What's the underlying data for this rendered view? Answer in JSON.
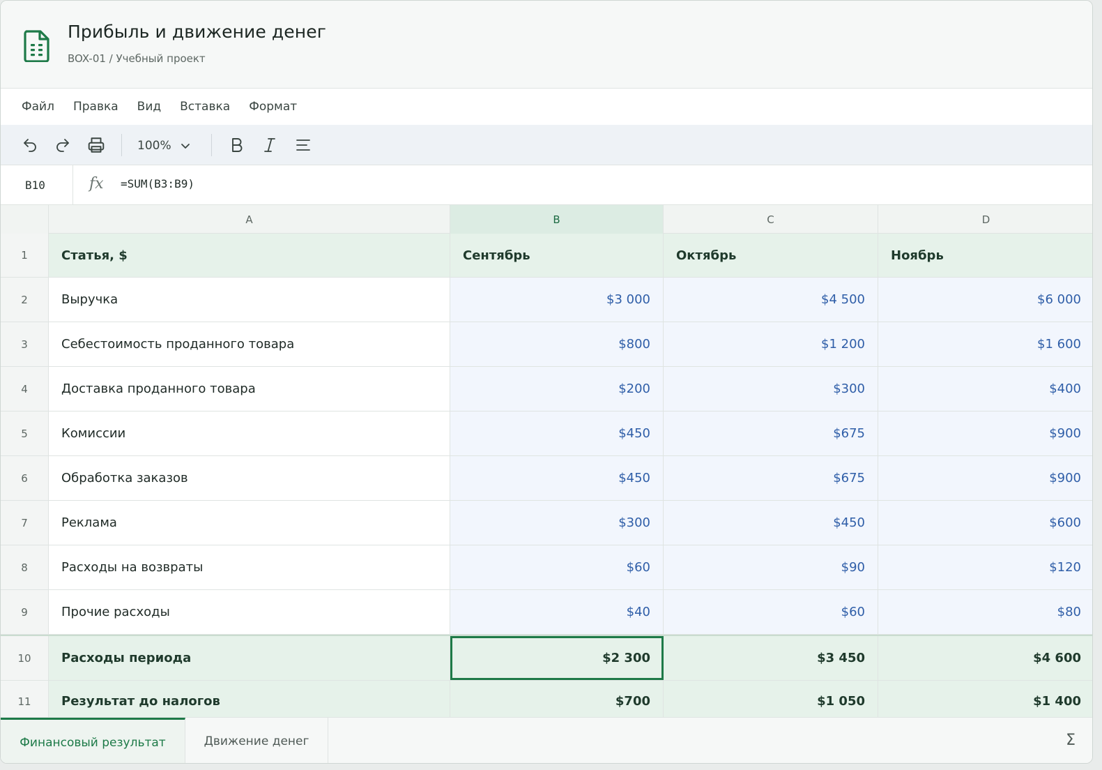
{
  "document": {
    "title": "Прибыль и движение денег",
    "subtitle": "BOX-01 / Учебный проект",
    "icon": "spreadsheet-doc-icon",
    "accent_color": "#1e7a48"
  },
  "menu": [
    "Файл",
    "Правка",
    "Вид",
    "Вставка",
    "Формат"
  ],
  "toolbar": {
    "zoom": "100%",
    "icons": [
      "undo-icon",
      "redo-icon",
      "print-icon",
      "bold-icon",
      "italic-icon",
      "align-icon"
    ]
  },
  "formula_bar": {
    "cell_ref": "B10",
    "fx": "fx",
    "formula": "=SUM(B3:B9)"
  },
  "grid": {
    "columns": [
      "A",
      "B",
      "C",
      "D"
    ],
    "active_column": "B",
    "rows": [
      {
        "num": "1",
        "cells": [
          "Статья, $",
          "Сентябрь",
          "Октябрь",
          "Ноябрь"
        ]
      },
      {
        "num": "2",
        "cells": [
          "Выручка",
          "$3 000",
          "$4 500",
          "$6 000"
        ]
      },
      {
        "num": "3",
        "cells": [
          "Себестоимость проданного товара",
          "$800",
          "$1 200",
          "$1 600"
        ]
      },
      {
        "num": "4",
        "cells": [
          "Доставка проданного товара",
          "$200",
          "$300",
          "$400"
        ]
      },
      {
        "num": "5",
        "cells": [
          "Комиссии",
          "$450",
          "$675",
          "$900"
        ]
      },
      {
        "num": "6",
        "cells": [
          "Обработка заказов",
          "$450",
          "$675",
          "$900"
        ]
      },
      {
        "num": "7",
        "cells": [
          "Реклама",
          "$300",
          "$450",
          "$600"
        ]
      },
      {
        "num": "8",
        "cells": [
          "Расходы на возвраты",
          "$60",
          "$90",
          "$120"
        ]
      },
      {
        "num": "9",
        "cells": [
          "Прочие расходы",
          "$40",
          "$60",
          "$80"
        ]
      },
      {
        "num": "10",
        "cells": [
          "Расходы периода",
          "$2 300",
          "$3 450",
          "$4 600"
        ]
      },
      {
        "num": "11",
        "cells": [
          "Результат до налогов",
          "$700",
          "$1 050",
          "$1 400"
        ]
      }
    ]
  },
  "sheets": {
    "tabs": [
      "Финансовый результат",
      "Движение денег"
    ],
    "active": "Финансовый результат",
    "sigma": "Σ"
  }
}
